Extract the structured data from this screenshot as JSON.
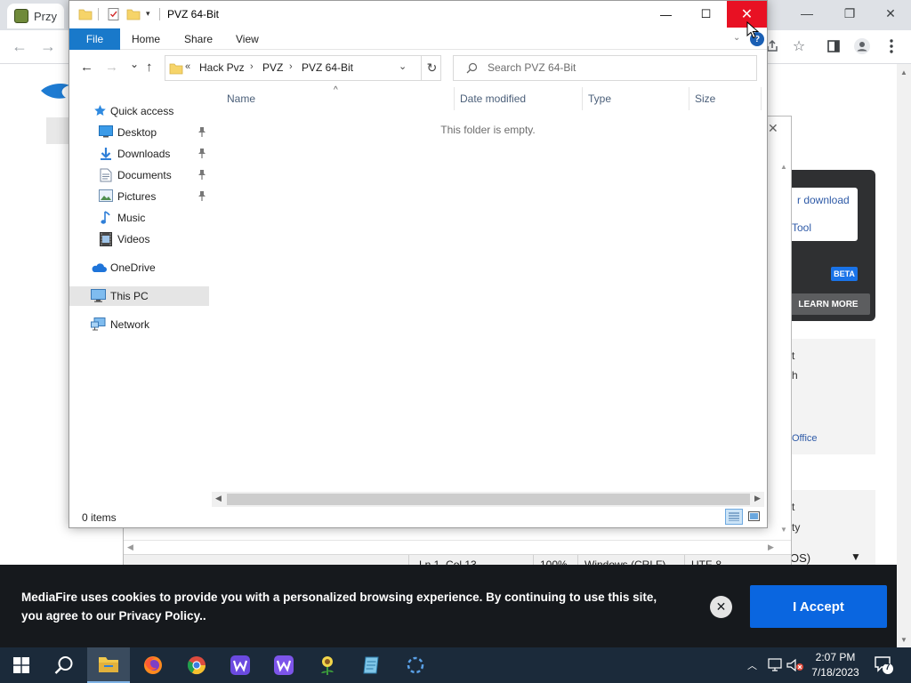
{
  "browser": {
    "tab_title": "Przy",
    "minimize": "—",
    "restore": "❐",
    "close": "✕",
    "back": "←",
    "forward": "→"
  },
  "mediafire": {
    "download_text": "r download",
    "tool_text": "Tool",
    "beta_badge": "BETA",
    "learn_more": "LEARN MORE",
    "t1": "t",
    "h1": "h",
    "office_text": "Office",
    "t2": "t",
    "y1": "ty",
    "os_dropdown": "OS)"
  },
  "editor": {
    "close": "✕",
    "status": {
      "position": "Ln 1, Col 13",
      "zoom": "100%",
      "line_endings": "Windows (CRLF)",
      "encoding": "UTF-8"
    }
  },
  "cookie_banner": {
    "text": "MediaFire uses cookies to provide you with a personalized browsing experience. By continuing to use this site, you agree to our Privacy Policy..",
    "close": "✕",
    "accept_label": "I Accept"
  },
  "explorer": {
    "title": "PVZ 64-Bit",
    "minimize": "—",
    "maximize": "☐",
    "close": "✕",
    "ribbon": {
      "file": "File",
      "home": "Home",
      "share": "Share",
      "view": "View",
      "help": "?"
    },
    "nav": {
      "back": "←",
      "forward": "→",
      "recent": "⌄",
      "up": "↑"
    },
    "address": {
      "overflow": "«",
      "parts": [
        "Hack Pvz",
        "PVZ",
        "PVZ 64-Bit"
      ],
      "separator": "›",
      "refresh": "↻"
    },
    "search": {
      "placeholder": "Search PVZ 64-Bit"
    },
    "nav_pane": {
      "quick_access": "Quick access",
      "desktop": "Desktop",
      "downloads": "Downloads",
      "documents": "Documents",
      "pictures": "Pictures",
      "music": "Music",
      "videos": "Videos",
      "onedrive": "OneDrive",
      "this_pc": "This PC",
      "network": "Network"
    },
    "columns": [
      "Name",
      "Date modified",
      "Type",
      "Size"
    ],
    "empty_message": "This folder is empty.",
    "status": "0 items"
  },
  "taskbar": {
    "time": "2:07 PM",
    "date": "7/18/2023",
    "notifications": "7"
  },
  "colors": {
    "explorer_close": "#e81123",
    "file_tab": "#1979ca",
    "accept_button": "#0a66e0",
    "banner_bg": "#16191d",
    "taskbar_bg": "#1b2a3a"
  }
}
